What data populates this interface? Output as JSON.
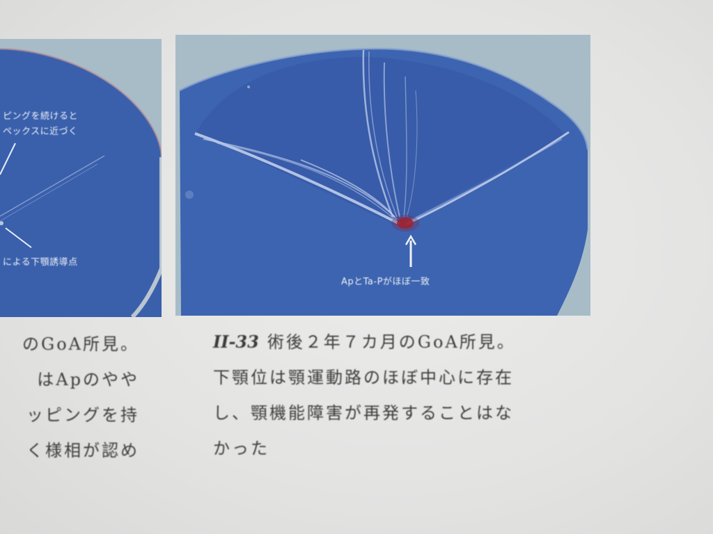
{
  "left_figure": {
    "labels": [
      "ピングを続けると",
      "ペックスに近づく",
      "による下顎誘導点"
    ]
  },
  "right_figure": {
    "label": "ApとTa-Pがほぼ一致"
  },
  "left_caption": {
    "lines": [
      "のGoA所見。",
      "はApのやや",
      "ッピングを持",
      "く様相が認め"
    ]
  },
  "right_caption": {
    "figure_number": "II-33",
    "lines": [
      "術後２年７カ月のGoA所見。",
      "下顎位は顎運動路のほぼ中心に存在",
      "し、顎機能障害が再発することはな",
      "かった"
    ]
  },
  "colors": {
    "tracing_blue": "#3d64b0",
    "tracing_dark": "#2f55a3",
    "apex_red": "#b0201c",
    "frame": "#a8bcc8"
  }
}
